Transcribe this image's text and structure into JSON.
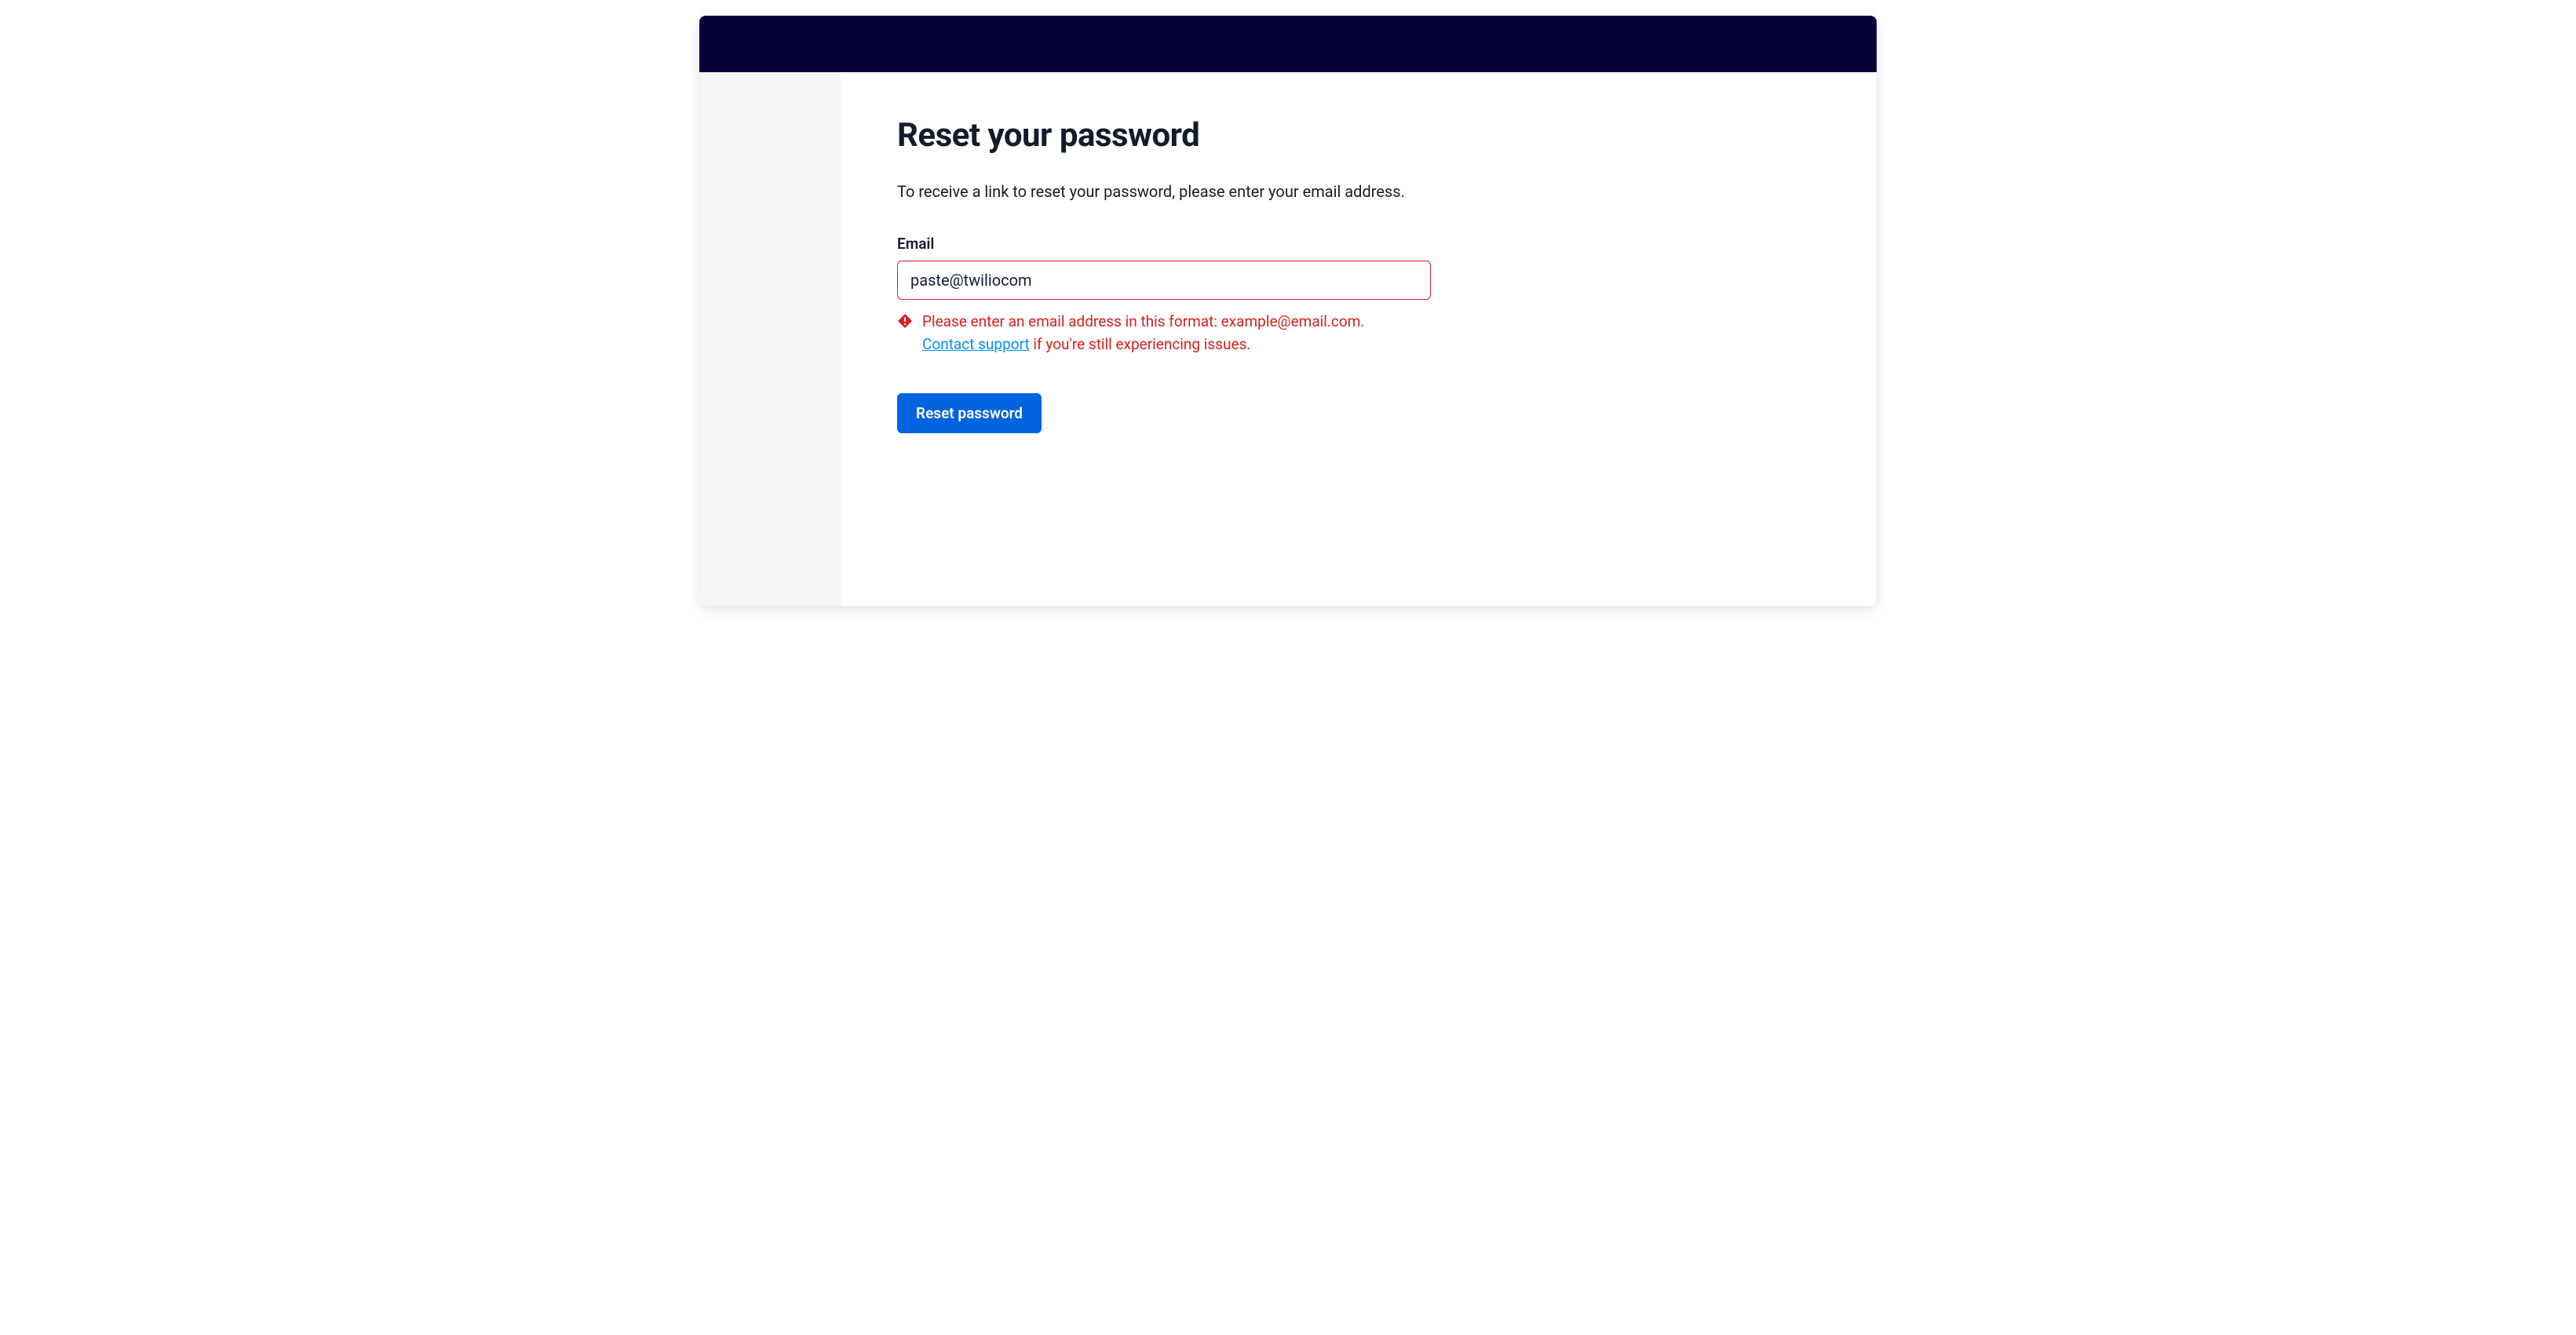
{
  "page": {
    "title": "Reset your password",
    "description": "To receive a link to reset your password, please enter your email address."
  },
  "form": {
    "email": {
      "label": "Email",
      "value": "paste@twiliocom"
    },
    "error": {
      "message_part1": "Please enter an email address in this format: example@email.com. ",
      "support_link_text": "Contact support",
      "message_part2": " if you're still experiencing issues."
    },
    "submit_label": "Reset password"
  },
  "colors": {
    "header_bg": "#06033a",
    "sidebar_bg": "#f4f4f6",
    "text_primary": "#121c2d",
    "error": "#d61f1f",
    "link": "#008cff",
    "button_primary": "#0263e0"
  }
}
